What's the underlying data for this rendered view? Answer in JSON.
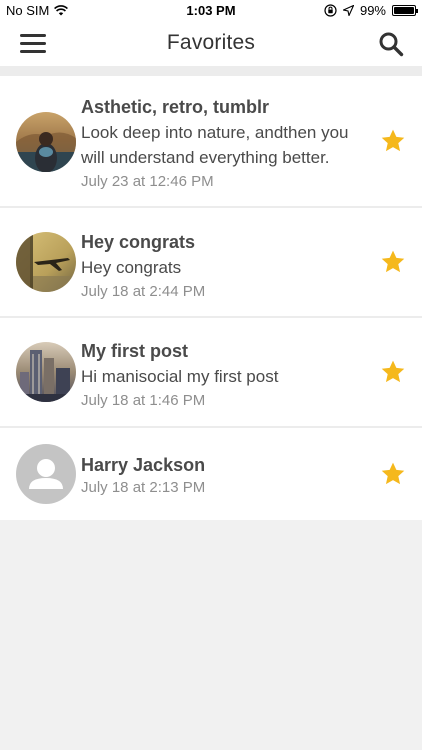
{
  "status": {
    "carrier": "No SIM",
    "time": "1:03 PM",
    "battery": "99%",
    "battery_level": 0.99
  },
  "header": {
    "title": "Favorites",
    "menu_icon": "hamburger-menu-icon",
    "search_icon": "search-icon"
  },
  "favorites": [
    {
      "title": "Asthetic, retro, tumblr",
      "text_line1": "Look deep into nature, andthen you",
      "text_line2": "will understand everything better.",
      "date": "July 23 at 12:46 PM",
      "avatar": "nature-person-photo"
    },
    {
      "title": "Hey congrats",
      "text_line1": "Hey congrats",
      "date": "July 18 at 2:44 PM",
      "avatar": "airplane-window-photo"
    },
    {
      "title": "My first post",
      "text_line1": "Hi manisocial my first post",
      "date": "July 18 at 1:46 PM",
      "avatar": "city-buildings-photo"
    },
    {
      "title": "Harry Jackson",
      "date": "July 18 at 2:13 PM",
      "avatar": "default-user-icon"
    }
  ],
  "colors": {
    "star": "#f5b81c",
    "background": "#f1f1f1",
    "text": "#4a4a4a",
    "date": "#8e8e8e"
  }
}
